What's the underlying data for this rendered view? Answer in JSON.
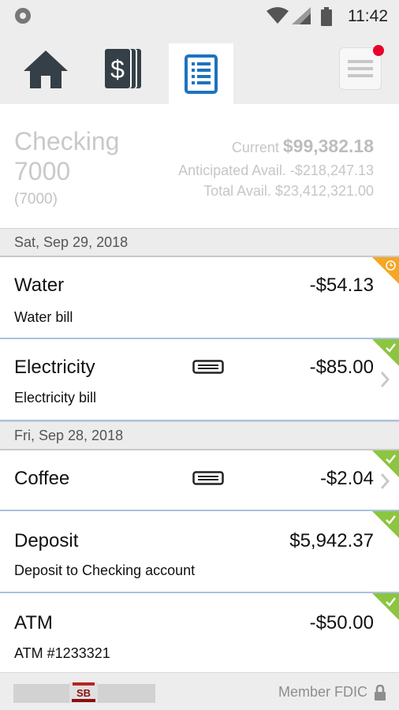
{
  "status_bar": {
    "time": "11:42"
  },
  "nav": {
    "tabs": [
      {
        "icon": "home-icon",
        "active": false
      },
      {
        "icon": "money-icon",
        "active": false
      },
      {
        "icon": "document-list-icon",
        "active": true
      }
    ],
    "menu_badge_color": "#e8002a"
  },
  "account": {
    "name_line1": "Checking",
    "name_line2": "7000",
    "number": "(7000)",
    "current_label": "Current",
    "current_value": "$99,382.18",
    "anticipated": "Anticipated Avail. -$218,247.13",
    "total": "Total Avail. $23,412,321.00"
  },
  "groups": [
    {
      "date": "Sat, Sep 29, 2018",
      "transactions": [
        {
          "name": "Water",
          "desc": "Water bill",
          "amount": "-$54.13",
          "status": "pending",
          "memo": false,
          "chevron": false
        },
        {
          "name": "Electricity",
          "desc": "Electricity bill",
          "amount": "-$85.00",
          "status": "cleared",
          "memo": true,
          "chevron": true
        }
      ]
    },
    {
      "date": "Fri, Sep 28, 2018",
      "transactions": [
        {
          "name": "Coffee",
          "desc": "",
          "amount": "-$2.04",
          "status": "cleared",
          "memo": true,
          "chevron": true
        },
        {
          "name": "Deposit",
          "desc": "Deposit to Checking account",
          "amount": "$5,942.37",
          "status": "cleared",
          "memo": false,
          "chevron": false
        },
        {
          "name": "ATM",
          "desc": "ATM #1233321",
          "amount": "-$50.00",
          "status": "cleared",
          "memo": false,
          "chevron": false
        }
      ]
    }
  ],
  "footer": {
    "member_text": "Member FDIC",
    "logo_text": "SB"
  },
  "colors": {
    "accent": "#1e73be",
    "cleared": "#8cc540",
    "pending": "#f5a623",
    "divider": "#a9c2e0"
  }
}
